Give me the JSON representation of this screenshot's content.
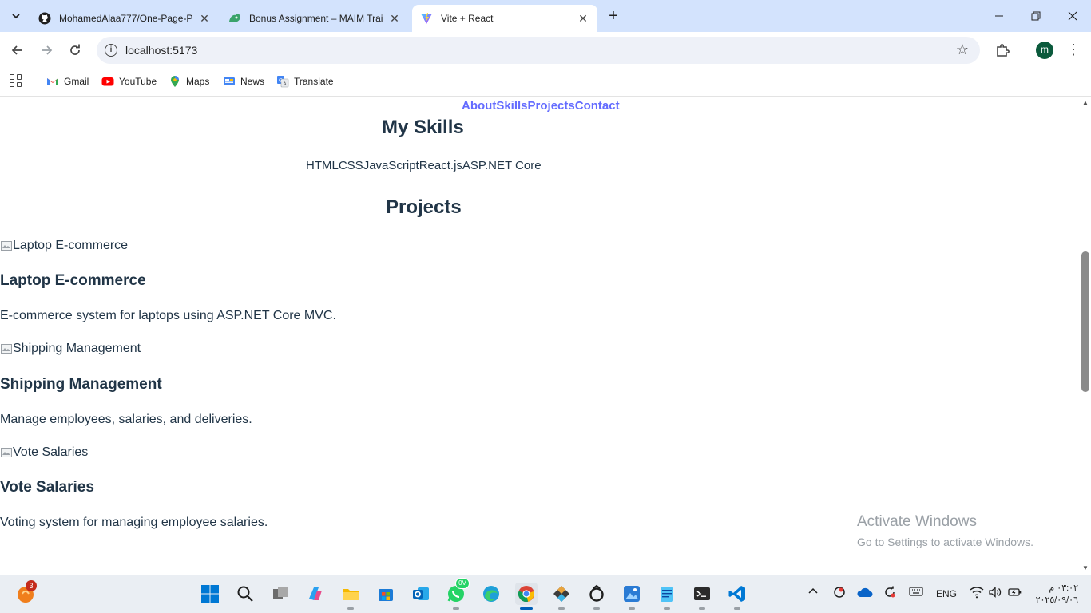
{
  "browser": {
    "tabs": [
      {
        "title": "MohamedAlaa777/One-Page-P",
        "icon": "github-icon",
        "active": false
      },
      {
        "title": "Bonus Assignment – MAIM Trai",
        "icon": "maim-icon",
        "active": false
      },
      {
        "title": "Vite + React",
        "icon": "vite-icon",
        "active": true
      }
    ],
    "url": "localhost:5173",
    "profile_initial": "m",
    "bookmarks": [
      {
        "label": "Gmail",
        "icon": "gmail-icon"
      },
      {
        "label": "YouTube",
        "icon": "youtube-icon"
      },
      {
        "label": "Maps",
        "icon": "maps-icon"
      },
      {
        "label": "News",
        "icon": "news-icon"
      },
      {
        "label": "Translate",
        "icon": "translate-icon"
      }
    ]
  },
  "page": {
    "nav": [
      "About",
      "Skills",
      "Projects",
      "Contact"
    ],
    "skills_heading": "My Skills",
    "skills": [
      "HTML",
      "CSS",
      "JavaScript",
      "React.js",
      "ASP.NET Core"
    ],
    "projects_heading": "Projects",
    "projects": [
      {
        "image_alt": "Laptop E-commerce",
        "title": "Laptop E-commerce",
        "description": "E-commerce system for laptops using ASP.NET Core MVC."
      },
      {
        "image_alt": "Shipping Management",
        "title": "Shipping Management",
        "description": "Manage employees, salaries, and deliveries."
      },
      {
        "image_alt": "Vote Salaries",
        "title": "Vote Salaries",
        "description": "Voting system for managing employee salaries."
      }
    ]
  },
  "watermark": {
    "line1": "Activate Windows",
    "line2": "Go to Settings to activate Windows."
  },
  "taskbar": {
    "notification_badge": "3",
    "whatsapp_badge": "0V",
    "language": "ENG",
    "time": "٠٣:٠٢ م",
    "date": "٢٠٢٥/٠٩/٠٦"
  },
  "colors": {
    "tabstrip": "#d3e3fd",
    "link": "#646cff",
    "text": "#213547"
  }
}
